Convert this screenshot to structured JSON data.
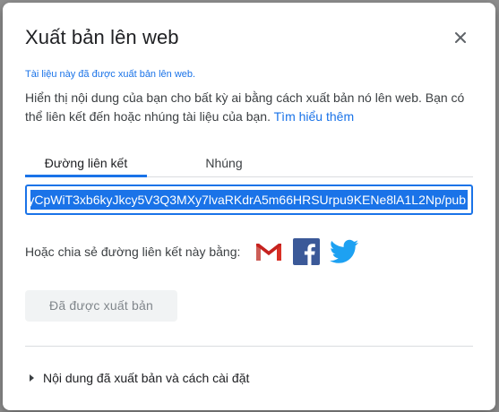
{
  "dialog": {
    "title": "Xuất bản lên web",
    "status_note": "Tài liệu này đã được xuất bản lên web.",
    "description": "Hiển thị nội dung của bạn cho bất kỳ ai bằng cách xuất bản nó lên web. Bạn có thể liên kết đến hoặc nhúng tài liệu của bạn.",
    "learn_more": "Tìm hiểu thêm",
    "close_icon": "close-icon"
  },
  "tabs": [
    {
      "label": "Đường liên kết",
      "active": true
    },
    {
      "label": "Nhúng",
      "active": false
    }
  ],
  "link": {
    "value": "yCpWiT3xb6kyJkcy5V3Q3MXy7lvaRKdrA5m66HRSUrpu9KENe8lA1L2Np/pub"
  },
  "share": {
    "label": "Hoặc chia sẻ đường liên kết này bằng:",
    "icons": [
      "gmail-icon",
      "facebook-icon",
      "twitter-icon"
    ]
  },
  "published_button": "Đã được xuất bản",
  "settings_toggle": "Nội dung đã xuất bản và cách cài đặt",
  "colors": {
    "accent": "#1a73e8",
    "facebook": "#3b5998",
    "twitter": "#1da1f2",
    "gmail_red": "#d93025"
  }
}
